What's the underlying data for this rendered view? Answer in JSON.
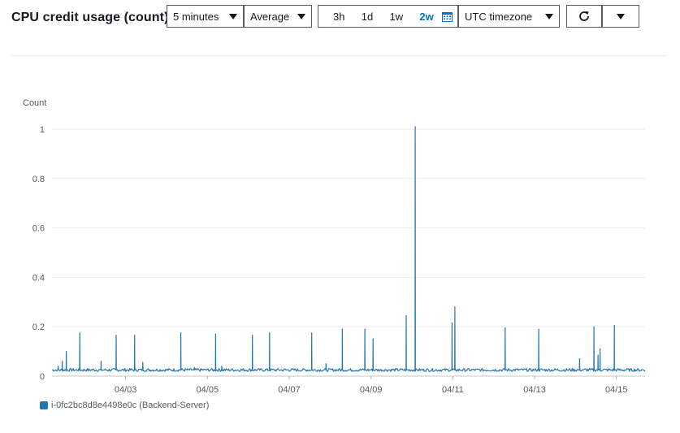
{
  "header": {
    "title": "CPU credit usage (count)",
    "period": "5 minutes",
    "statistic": "Average",
    "ranges": [
      "3h",
      "1d",
      "1w",
      "2w"
    ],
    "active_range": "2w",
    "timezone": "UTC timezone",
    "icons": {
      "calendar": "calendar-icon",
      "refresh": "refresh-icon",
      "more": "caret-down-icon"
    }
  },
  "legend": {
    "label": "i-0fc2bc8d8e4498e0c (Backend-Server)"
  },
  "chart_data": {
    "type": "line",
    "ylabel": "Count",
    "ylim": [
      0,
      1.0
    ],
    "yticks": [
      0,
      0.2,
      0.4,
      0.6,
      0.8,
      1
    ],
    "xlim": [
      1.2,
      15.7
    ],
    "xticks": [
      {
        "v": 3,
        "label": "04/03"
      },
      {
        "v": 5,
        "label": "04/05"
      },
      {
        "v": 7,
        "label": "04/07"
      },
      {
        "v": 9,
        "label": "04/09"
      },
      {
        "v": 11,
        "label": "04/11"
      },
      {
        "v": 13,
        "label": "04/13"
      },
      {
        "v": 15,
        "label": "04/15"
      }
    ],
    "baseline": 0.025,
    "color": "#1f77b4",
    "series": [
      {
        "name": "i-0fc2bc8d8e4498e0c (Backend-Server)",
        "spikes": [
          [
            1.35,
            0.04
          ],
          [
            1.45,
            0.06
          ],
          [
            1.55,
            0.1
          ],
          [
            1.88,
            0.175
          ],
          [
            2.4,
            0.06
          ],
          [
            2.77,
            0.165
          ],
          [
            3.22,
            0.165
          ],
          [
            3.42,
            0.055
          ],
          [
            4.35,
            0.175
          ],
          [
            4.68,
            0.035
          ],
          [
            5.2,
            0.17
          ],
          [
            5.35,
            0.04
          ],
          [
            6.1,
            0.165
          ],
          [
            6.52,
            0.175
          ],
          [
            7.55,
            0.175
          ],
          [
            7.9,
            0.05
          ],
          [
            8.3,
            0.19
          ],
          [
            8.85,
            0.19
          ],
          [
            9.05,
            0.15
          ],
          [
            9.86,
            0.245
          ],
          [
            10.08,
            1.01
          ],
          [
            10.98,
            0.215
          ],
          [
            11.05,
            0.28
          ],
          [
            12.28,
            0.195
          ],
          [
            13.1,
            0.19
          ],
          [
            14.1,
            0.07
          ],
          [
            14.45,
            0.2
          ],
          [
            14.55,
            0.085
          ],
          [
            14.6,
            0.11
          ],
          [
            14.95,
            0.205
          ]
        ]
      }
    ]
  }
}
